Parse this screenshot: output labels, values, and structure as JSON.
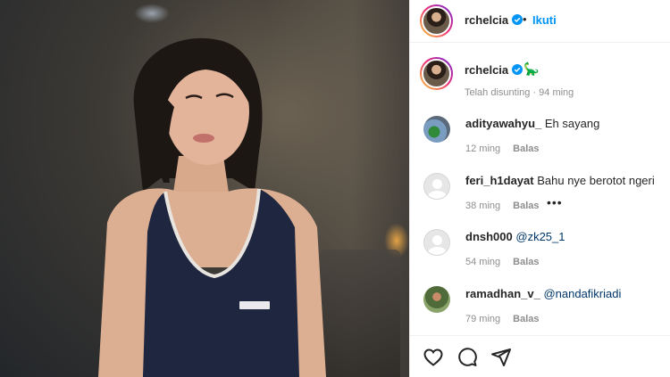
{
  "post": {
    "username": "rchelcia",
    "follow_label": "Ikuti",
    "separator": "•",
    "verified_icon": "verified-badge-icon",
    "accent_color": "#0095f6"
  },
  "caption": {
    "username": "rchelcia",
    "emoji": "🦕",
    "meta": "Telah disunting · 94 ming"
  },
  "comments": [
    {
      "username": "adityawahyu_",
      "text": "Eh sayang",
      "mention": "",
      "time": "12 ming",
      "reply": "Balas",
      "more": ""
    },
    {
      "username": "feri_h1dayat",
      "text": "Bahu nye berotot ngeri",
      "mention": "",
      "time": "38 ming",
      "reply": "Balas",
      "more": "•••"
    },
    {
      "username": "dnsh000",
      "text": "",
      "mention": "@zk25_1",
      "time": "54 ming",
      "reply": "Balas",
      "more": ""
    },
    {
      "username": "ramadhan_v_",
      "text": "",
      "mention": "@nandafikriadi",
      "time": "79 ming",
      "reply": "Balas",
      "more": ""
    }
  ],
  "actions": {
    "like_icon": "heart-icon",
    "comment_icon": "comment-icon",
    "share_icon": "send-icon"
  }
}
